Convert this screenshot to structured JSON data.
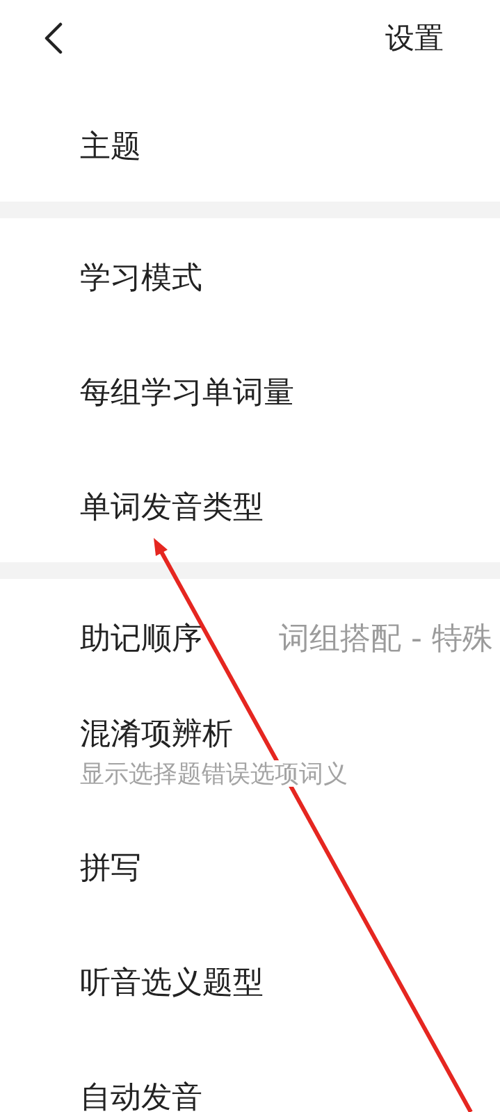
{
  "header": {
    "title": "设置"
  },
  "sections": [
    {
      "items": [
        {
          "label": "主题"
        }
      ]
    },
    {
      "items": [
        {
          "label": "学习模式"
        },
        {
          "label": "每组学习单词量"
        },
        {
          "label": "单词发音类型"
        }
      ]
    },
    {
      "items": [
        {
          "label": "助记顺序",
          "value": "词组搭配 - 特殊"
        },
        {
          "label": "混淆项辨析",
          "description": "显示选择题错误选项词义"
        },
        {
          "label": "拼写"
        },
        {
          "label": "听音选义题型"
        },
        {
          "label": "自动发音"
        }
      ]
    }
  ],
  "annotation": {
    "kind": "arrow"
  }
}
